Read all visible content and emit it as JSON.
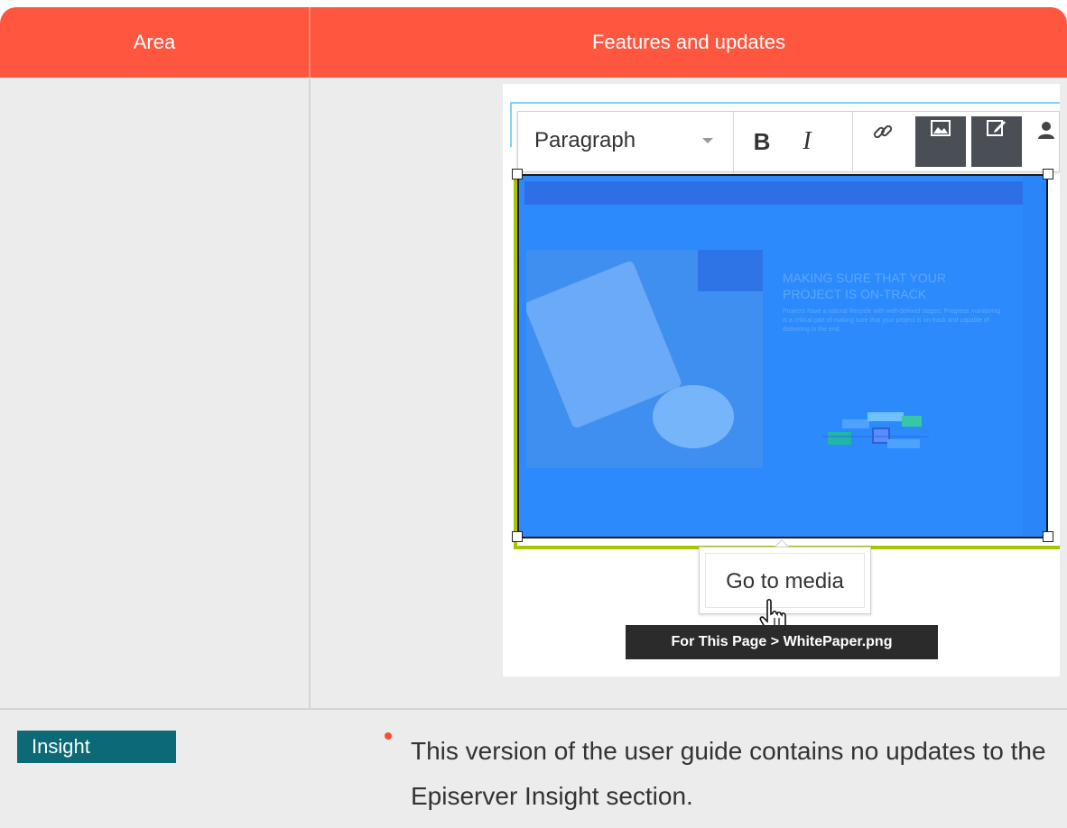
{
  "table": {
    "headers": [
      "Area",
      "Features and updates"
    ],
    "colors": {
      "header_bg": "#ff563f",
      "row_bg": "#ececec",
      "tag_bg": "#0b6a76",
      "bullet": "#ff4b2e"
    }
  },
  "screenshot": {
    "toolbar": {
      "format_select": "Paragraph",
      "bold_label": "B",
      "italic_label": "I",
      "icons": [
        "link-icon",
        "image-icon",
        "edit-icon",
        "user-icon"
      ]
    },
    "image_content": {
      "heading": "MAKING SURE THAT YOUR PROJECT IS ON-TRACK",
      "body": "Projects have a natural lifecycle with well-defined stages. Progress monitoring is a critical part of making sure that your project is on-track and capable of delivering in the end.",
      "colors": {
        "image_bg": "#2d8afc",
        "selection_border": "#a8c400"
      }
    },
    "tooltip": "Go to media",
    "path_label": "For This Page > WhitePaper.png"
  },
  "row2": {
    "area_tag": "Insight",
    "bullet_text": "This version of the user guide contains no updates to the Episerver Insight section."
  }
}
